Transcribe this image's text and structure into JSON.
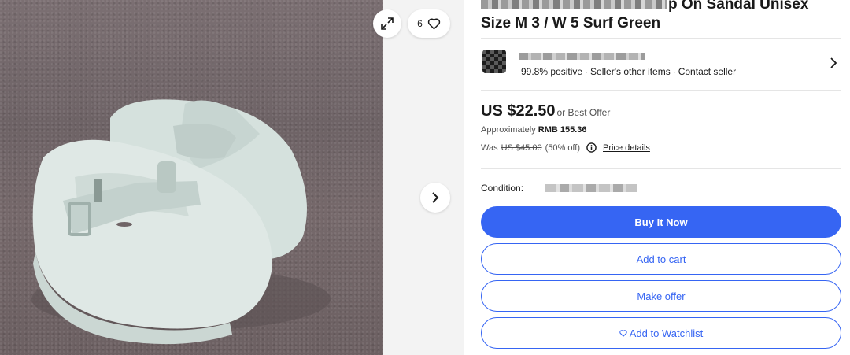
{
  "gallery": {
    "watch_count": "6",
    "icons": {
      "expand": "expand-icon",
      "watch": "heart-icon",
      "next": "chevron-right-icon"
    }
  },
  "listing": {
    "title_visible_1": "p On Sandal Unisex",
    "title_visible_2": "Size M 3 / W 5 Surf Green"
  },
  "seller": {
    "feedback": "99.8% positive",
    "other_items": "Seller's other items",
    "contact": "Contact seller",
    "separator": "·"
  },
  "price": {
    "amount": "US $22.50",
    "best_offer": "or Best Offer",
    "approx_label": "Approximately",
    "approx_value": "RMB 155.36",
    "was_label": "Was",
    "was_value": "US $45.00",
    "discount": "(50% off)",
    "price_details": "Price details"
  },
  "condition": {
    "label": "Condition:"
  },
  "actions": {
    "buy_now": "Buy It Now",
    "add_to_cart": "Add to cart",
    "make_offer": "Make offer",
    "add_to_watchlist": "Add to Watchlist"
  },
  "colors": {
    "primary": "#3665f3",
    "text": "#191919",
    "muted": "#505050",
    "divider": "#e5e5e5"
  }
}
